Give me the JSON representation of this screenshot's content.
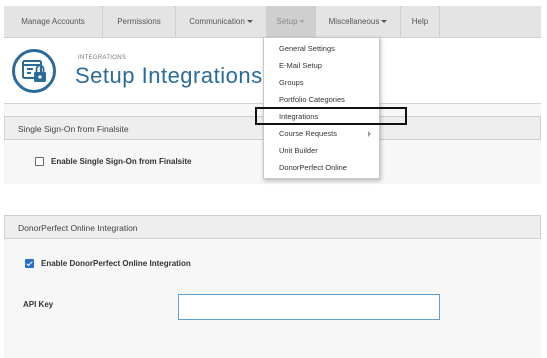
{
  "nav": {
    "items": [
      {
        "label": "Manage Accounts",
        "has_caret": false
      },
      {
        "label": "Permissions",
        "has_caret": false
      },
      {
        "label": "Communication",
        "has_caret": true
      },
      {
        "label": "Setup",
        "has_caret": true,
        "active": true
      },
      {
        "label": "Miscellaneous",
        "has_caret": true
      },
      {
        "label": "Help",
        "has_caret": false
      }
    ]
  },
  "header": {
    "section_label": "INTEGRATIONS",
    "title": "Setup Integrations",
    "icon": "browser-lock-icon"
  },
  "setup_menu": {
    "items": [
      {
        "label": "General Settings"
      },
      {
        "label": "E-Mail Setup"
      },
      {
        "label": "Groups"
      },
      {
        "label": "Portfolio Categories"
      },
      {
        "label": "Integrations",
        "highlighted": true
      },
      {
        "label": "Course Requests",
        "has_submenu": true
      },
      {
        "label": "Unit Builder"
      },
      {
        "label": "DonorPerfect Online"
      }
    ]
  },
  "sso_panel": {
    "heading": "Single Sign-On from Finalsite",
    "checkbox_label": "Enable Single Sign-On from Finalsite",
    "checked": false
  },
  "dpo_panel": {
    "heading": "DonorPerfect Online Integration",
    "checkbox_label": "Enable DonorPerfect Online Integration",
    "checked": true,
    "api_key_label": "API Key",
    "api_key_value": ""
  },
  "colors": {
    "accent": "#2a6b9a",
    "checkbox_checked": "#2a6fc9",
    "input_border": "#5aa0d6",
    "nav_bg": "#e4e4e4"
  }
}
